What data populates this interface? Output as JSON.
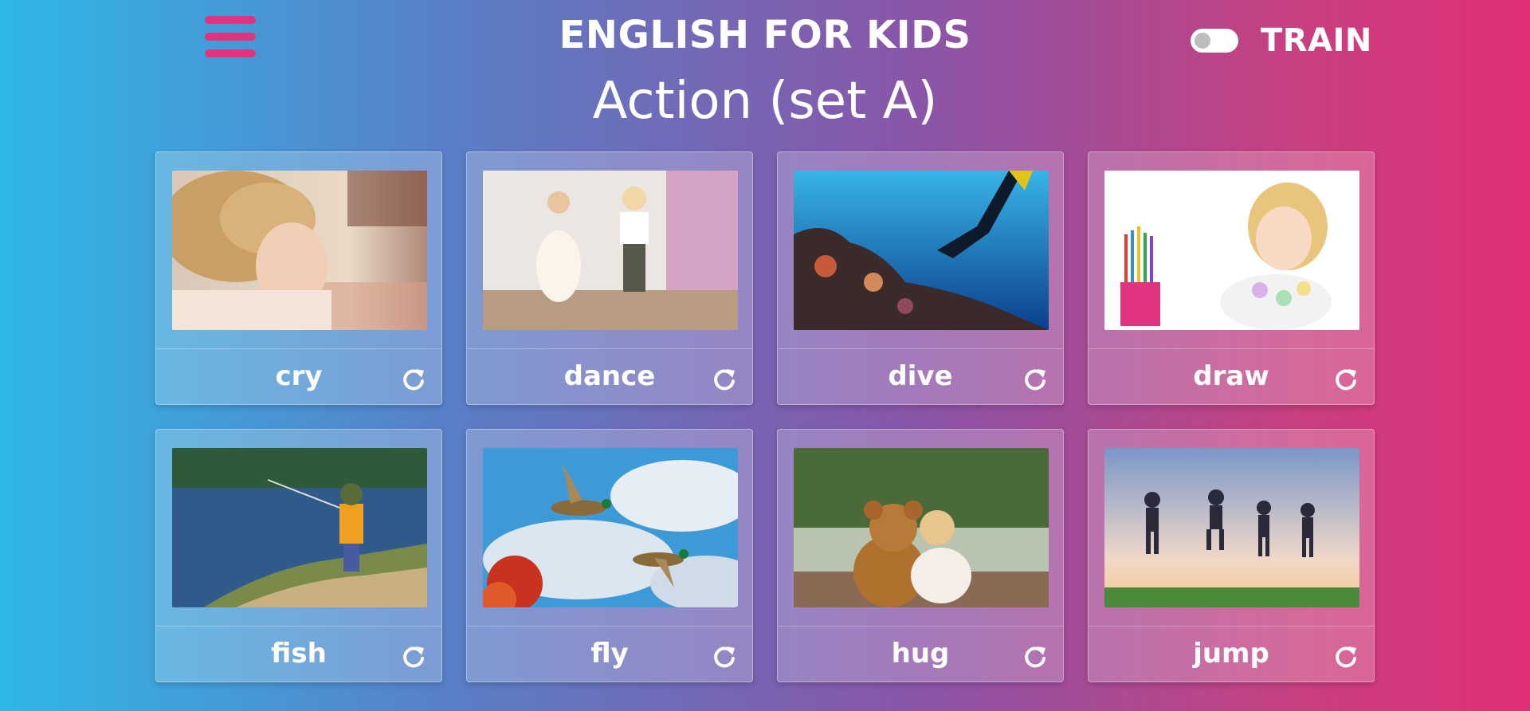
{
  "header": {
    "app_title": "ENGLISH FOR KIDS",
    "mode_label": "TRAIN",
    "menu_icon": "hamburger-menu-icon",
    "accent_color": "#e0347e"
  },
  "page": {
    "title": "Action (set A)"
  },
  "cards": [
    {
      "word": "cry",
      "image": "child-covering-face",
      "flip_icon": "rotate-icon"
    },
    {
      "word": "dance",
      "image": "children-dancing",
      "flip_icon": "rotate-icon"
    },
    {
      "word": "dive",
      "image": "diver-underwater",
      "flip_icon": "rotate-icon"
    },
    {
      "word": "draw",
      "image": "girl-drawing",
      "flip_icon": "rotate-icon"
    },
    {
      "word": "fish",
      "image": "boy-fishing",
      "flip_icon": "rotate-icon"
    },
    {
      "word": "fly",
      "image": "ducks-flying",
      "flip_icon": "rotate-icon"
    },
    {
      "word": "hug",
      "image": "girl-hugging-teddy-bear",
      "flip_icon": "rotate-icon"
    },
    {
      "word": "jump",
      "image": "kids-jumping",
      "flip_icon": "rotate-icon"
    }
  ]
}
